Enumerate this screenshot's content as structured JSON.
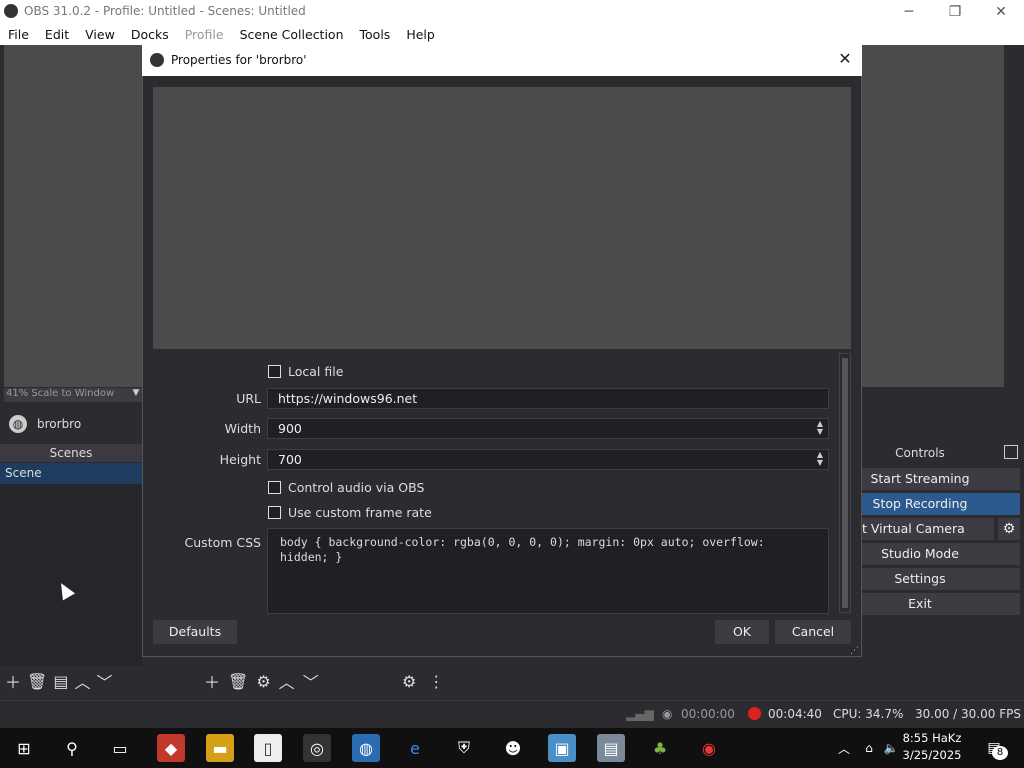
{
  "window": {
    "title": "OBS 31.0.2 - Profile: Untitled - Scenes: Untitled"
  },
  "menu": [
    "File",
    "Edit",
    "View",
    "Docks",
    "Profile",
    "Scene Collection",
    "Tools",
    "Help"
  ],
  "preview": {
    "scale_label": "41% Scale to Window"
  },
  "source_name": "brorbro",
  "scenes": {
    "header": "Scenes",
    "items": [
      "Scene"
    ]
  },
  "controls": {
    "header": "Controls",
    "start_streaming": "Start Streaming",
    "stop_recording": "Stop Recording",
    "virtual_camera": "art Virtual Camera",
    "studio_mode": "Studio Mode",
    "settings": "Settings",
    "exit": "Exit"
  },
  "dialog": {
    "title": "Properties for 'brorbro'",
    "local_file_label": "Local file",
    "local_file_checked": false,
    "url_label": "URL",
    "url_value": "https://windows96.net",
    "width_label": "Width",
    "width_value": "900",
    "height_label": "Height",
    "height_value": "700",
    "control_audio_label": "Control audio via OBS",
    "custom_fps_label": "Use custom frame rate",
    "custom_css_label": "Custom CSS",
    "custom_css_value": "body { background-color: rgba(0, 0, 0, 0); margin: 0px auto; overflow:\nhidden; }",
    "defaults_button": "Defaults",
    "ok_button": "OK",
    "cancel_button": "Cancel"
  },
  "status": {
    "stream_time": "00:00:00",
    "rec_time": "00:04:40",
    "cpu": "CPU: 34.7%",
    "fps": "30.00 / 30.00 FPS"
  },
  "taskbar": {
    "time": "8:55 HaKz",
    "date": "3/25/2025",
    "notifications": "8"
  },
  "colors": {
    "accent": "#2d5a8e",
    "rec": "#e02020"
  }
}
